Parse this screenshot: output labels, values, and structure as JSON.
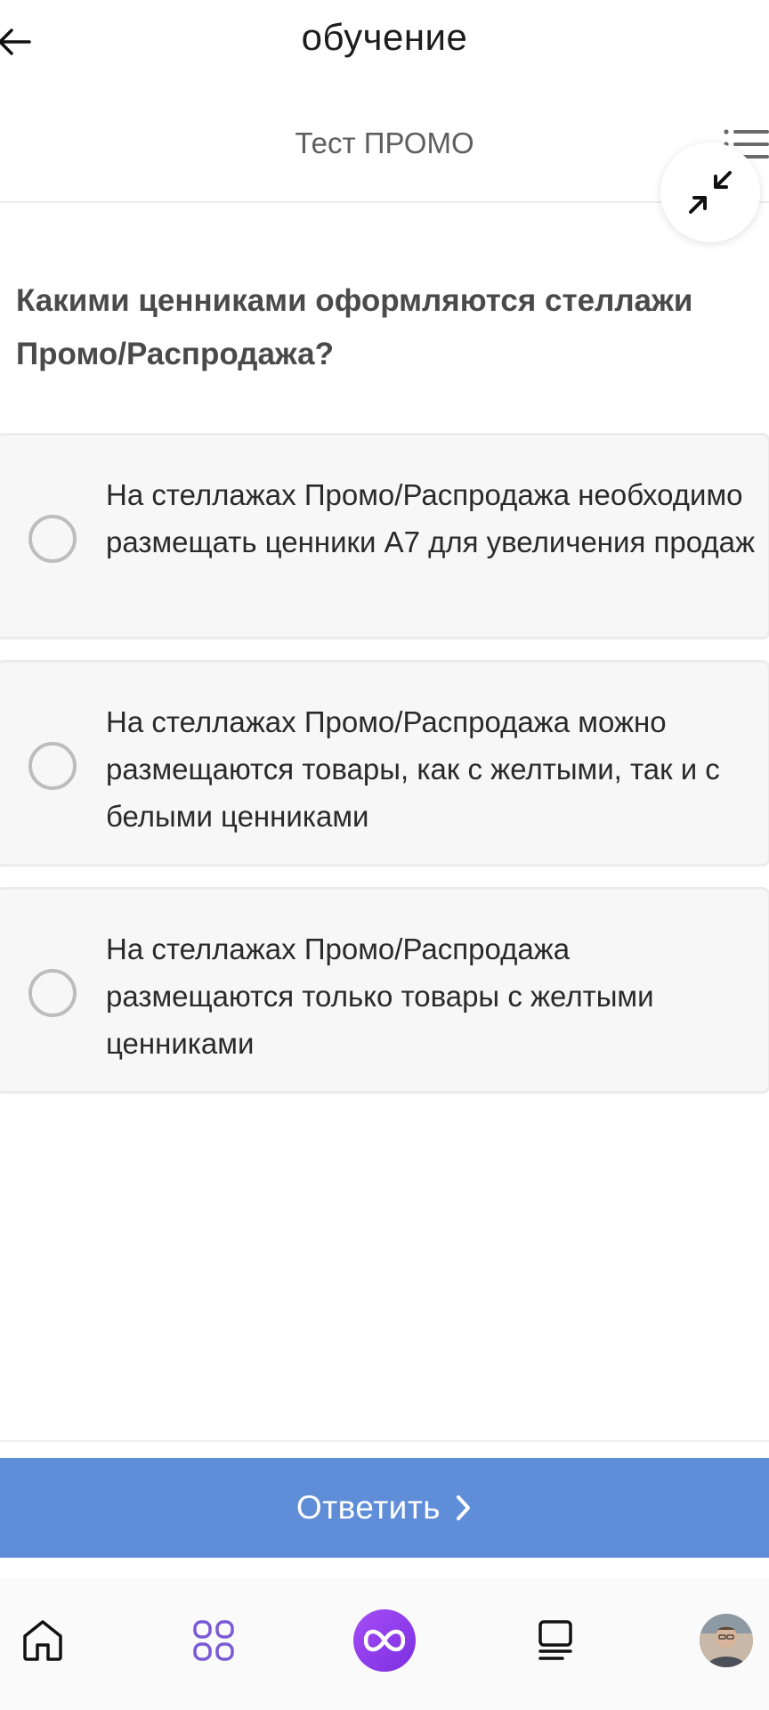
{
  "header": {
    "title": "обучение"
  },
  "test": {
    "title": "Тест ПРОМО"
  },
  "question": {
    "text": "Какими ценниками оформляются стеллажи Промо/Распродажа?"
  },
  "options": [
    {
      "text": "На стеллажах Промо/Распродажа необходимо размещать ценники А7 для увеличения продаж",
      "selected": false
    },
    {
      "text": "На стеллажах Промо/Распродажа можно размещаются товары, как с желтыми, так и с белыми ценниками",
      "selected": false
    },
    {
      "text": "На стеллажах Промо/Распродажа размещаются только товары с желтыми ценниками",
      "selected": false
    }
  ],
  "answer_button": {
    "label": "Ответить"
  },
  "colors": {
    "accent": "#5f8dd8",
    "center_button": "#8e3bef",
    "nav_icon_active": "#7a5ad6"
  },
  "icons": {
    "back": "arrow-left-icon",
    "list": "list-icon",
    "collapse": "collapse-arrows-icon",
    "home": "home-icon",
    "apps": "grid-icon",
    "center": "infinity-icon",
    "feed": "feed-icon",
    "profile": "avatar"
  }
}
